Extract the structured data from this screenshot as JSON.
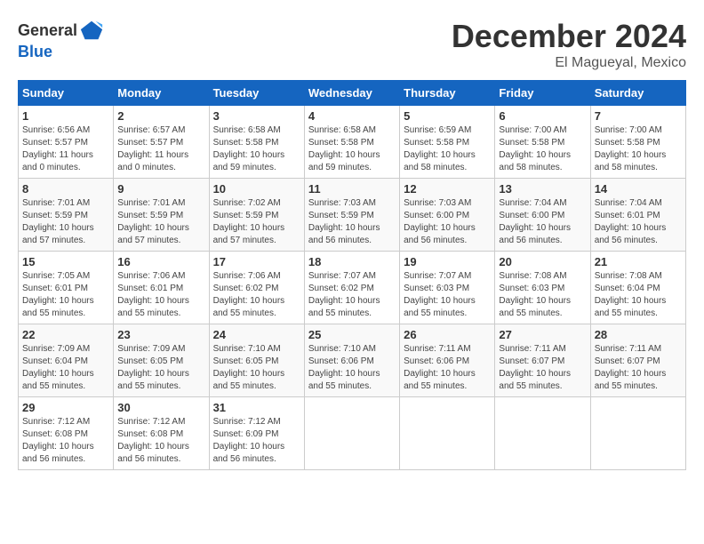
{
  "header": {
    "logo_general": "General",
    "logo_blue": "Blue",
    "month": "December 2024",
    "location": "El Magueyal, Mexico"
  },
  "weekdays": [
    "Sunday",
    "Monday",
    "Tuesday",
    "Wednesday",
    "Thursday",
    "Friday",
    "Saturday"
  ],
  "weeks": [
    [
      {
        "day": "1",
        "sunrise": "6:56 AM",
        "sunset": "5:57 PM",
        "daylight": "11 hours and 0 minutes."
      },
      {
        "day": "2",
        "sunrise": "6:57 AM",
        "sunset": "5:57 PM",
        "daylight": "11 hours and 0 minutes."
      },
      {
        "day": "3",
        "sunrise": "6:58 AM",
        "sunset": "5:58 PM",
        "daylight": "10 hours and 59 minutes."
      },
      {
        "day": "4",
        "sunrise": "6:58 AM",
        "sunset": "5:58 PM",
        "daylight": "10 hours and 59 minutes."
      },
      {
        "day": "5",
        "sunrise": "6:59 AM",
        "sunset": "5:58 PM",
        "daylight": "10 hours and 58 minutes."
      },
      {
        "day": "6",
        "sunrise": "7:00 AM",
        "sunset": "5:58 PM",
        "daylight": "10 hours and 58 minutes."
      },
      {
        "day": "7",
        "sunrise": "7:00 AM",
        "sunset": "5:58 PM",
        "daylight": "10 hours and 58 minutes."
      }
    ],
    [
      {
        "day": "8",
        "sunrise": "7:01 AM",
        "sunset": "5:59 PM",
        "daylight": "10 hours and 57 minutes."
      },
      {
        "day": "9",
        "sunrise": "7:01 AM",
        "sunset": "5:59 PM",
        "daylight": "10 hours and 57 minutes."
      },
      {
        "day": "10",
        "sunrise": "7:02 AM",
        "sunset": "5:59 PM",
        "daylight": "10 hours and 57 minutes."
      },
      {
        "day": "11",
        "sunrise": "7:03 AM",
        "sunset": "5:59 PM",
        "daylight": "10 hours and 56 minutes."
      },
      {
        "day": "12",
        "sunrise": "7:03 AM",
        "sunset": "6:00 PM",
        "daylight": "10 hours and 56 minutes."
      },
      {
        "day": "13",
        "sunrise": "7:04 AM",
        "sunset": "6:00 PM",
        "daylight": "10 hours and 56 minutes."
      },
      {
        "day": "14",
        "sunrise": "7:04 AM",
        "sunset": "6:01 PM",
        "daylight": "10 hours and 56 minutes."
      }
    ],
    [
      {
        "day": "15",
        "sunrise": "7:05 AM",
        "sunset": "6:01 PM",
        "daylight": "10 hours and 55 minutes."
      },
      {
        "day": "16",
        "sunrise": "7:06 AM",
        "sunset": "6:01 PM",
        "daylight": "10 hours and 55 minutes."
      },
      {
        "day": "17",
        "sunrise": "7:06 AM",
        "sunset": "6:02 PM",
        "daylight": "10 hours and 55 minutes."
      },
      {
        "day": "18",
        "sunrise": "7:07 AM",
        "sunset": "6:02 PM",
        "daylight": "10 hours and 55 minutes."
      },
      {
        "day": "19",
        "sunrise": "7:07 AM",
        "sunset": "6:03 PM",
        "daylight": "10 hours and 55 minutes."
      },
      {
        "day": "20",
        "sunrise": "7:08 AM",
        "sunset": "6:03 PM",
        "daylight": "10 hours and 55 minutes."
      },
      {
        "day": "21",
        "sunrise": "7:08 AM",
        "sunset": "6:04 PM",
        "daylight": "10 hours and 55 minutes."
      }
    ],
    [
      {
        "day": "22",
        "sunrise": "7:09 AM",
        "sunset": "6:04 PM",
        "daylight": "10 hours and 55 minutes."
      },
      {
        "day": "23",
        "sunrise": "7:09 AM",
        "sunset": "6:05 PM",
        "daylight": "10 hours and 55 minutes."
      },
      {
        "day": "24",
        "sunrise": "7:10 AM",
        "sunset": "6:05 PM",
        "daylight": "10 hours and 55 minutes."
      },
      {
        "day": "25",
        "sunrise": "7:10 AM",
        "sunset": "6:06 PM",
        "daylight": "10 hours and 55 minutes."
      },
      {
        "day": "26",
        "sunrise": "7:11 AM",
        "sunset": "6:06 PM",
        "daylight": "10 hours and 55 minutes."
      },
      {
        "day": "27",
        "sunrise": "7:11 AM",
        "sunset": "6:07 PM",
        "daylight": "10 hours and 55 minutes."
      },
      {
        "day": "28",
        "sunrise": "7:11 AM",
        "sunset": "6:07 PM",
        "daylight": "10 hours and 55 minutes."
      }
    ],
    [
      {
        "day": "29",
        "sunrise": "7:12 AM",
        "sunset": "6:08 PM",
        "daylight": "10 hours and 56 minutes."
      },
      {
        "day": "30",
        "sunrise": "7:12 AM",
        "sunset": "6:08 PM",
        "daylight": "10 hours and 56 minutes."
      },
      {
        "day": "31",
        "sunrise": "7:12 AM",
        "sunset": "6:09 PM",
        "daylight": "10 hours and 56 minutes."
      },
      null,
      null,
      null,
      null
    ]
  ]
}
